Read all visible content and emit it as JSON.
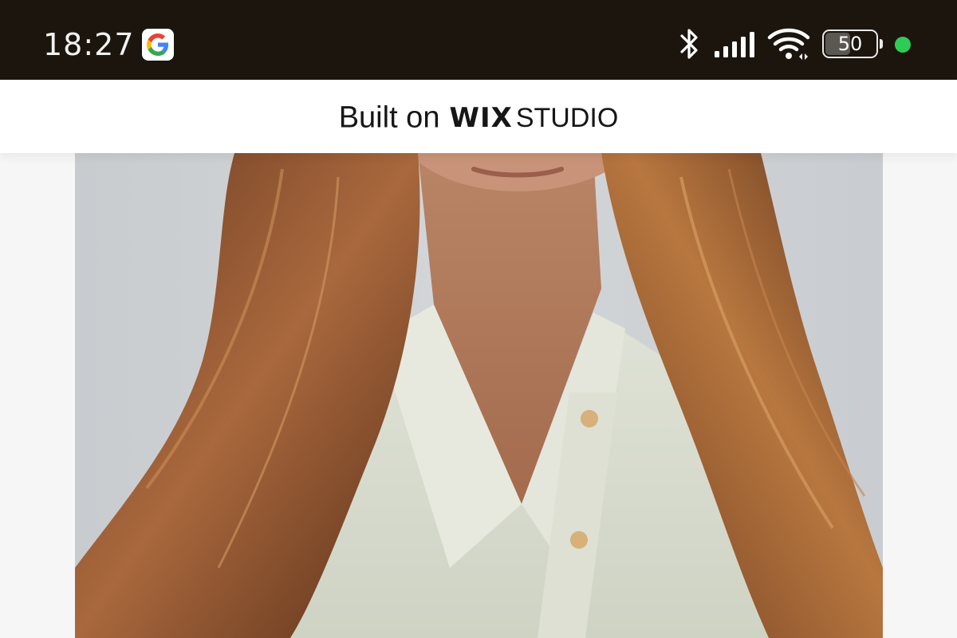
{
  "status_bar": {
    "time": "18:27",
    "battery_level": "50",
    "battery_fraction": 0.5,
    "notification_icon": "google-icon",
    "connectivity_icons": [
      "bluetooth-icon",
      "signal-icon",
      "wifi-icon",
      "battery-icon"
    ],
    "indicator_dot_color": "#2ecc55",
    "background_color": "#1b150e"
  },
  "banner": {
    "text": "Built on",
    "brand_primary": "WIX",
    "brand_secondary": "STUDIO"
  }
}
